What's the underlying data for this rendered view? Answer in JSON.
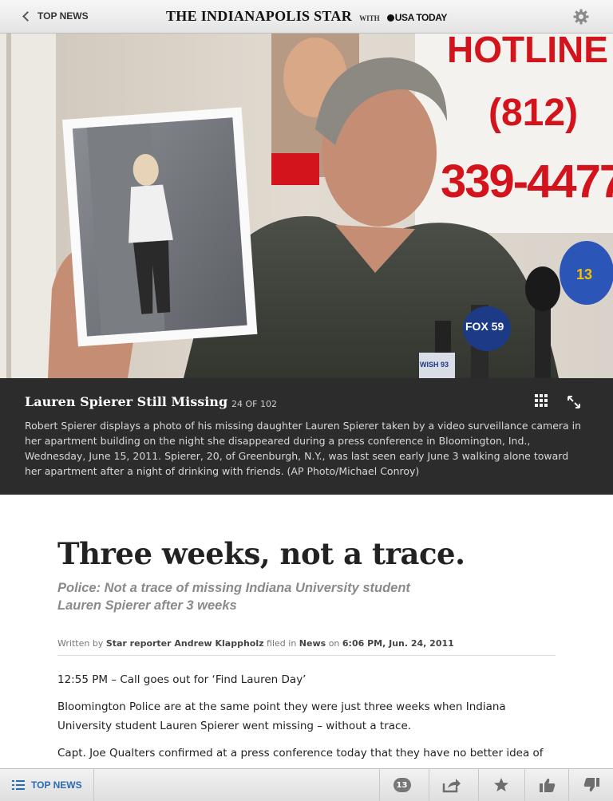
{
  "header": {
    "back_label": "TOP NEWS",
    "paper_name": "The Indianapolis Star",
    "with_label": "WITH",
    "partner_name": "USA TODAY"
  },
  "photo": {
    "sign_top": "HOTLINE",
    "sign_area": "(812)",
    "sign_number": "339-4477",
    "mic_labels": [
      "FOX 59",
      "13",
      "WISH 93"
    ]
  },
  "caption": {
    "title": "Lauren Spierer Still Missing",
    "counter": "24 OF 102",
    "text": "Robert Spierer displays a photo of his missing daughter Lauren Spierer taken by a video surveillance camera in her apartment building on the night she disappeared during a press conference in Bloomington, Ind., Wednesday, June 15, 2011. Spierer, 20, of Greenburgh, N.Y., was last seen early June 3 walking alone toward her apartment after a night of drinking with friends. (AP Photo/Michael Conroy)"
  },
  "article": {
    "headline": "Three weeks, not a trace.",
    "subhead": "Police: Not a trace of missing Indiana University student Lauren Spierer after 3 weeks",
    "byline": {
      "written_by": "Written by",
      "author": "Star reporter Andrew Klappholz",
      "filed_in": "filed in",
      "section": "News",
      "on": "on",
      "datetime": "6:06 PM, Jun. 24, 2011"
    },
    "paragraphs": [
      "12:55 PM – Call goes out for ‘Find Lauren Day’",
      "Bloomington Police are at the same point they were just three weeks when Indiana University student Lauren Spierer went missing – without a trace.",
      "Capt. Joe Qualters confirmed at a press conference today that they have no better idea of"
    ]
  },
  "footer": {
    "top_news_label": "TOP NEWS",
    "comment_count": "13"
  },
  "colors": {
    "caption_bg": "#2c2c2c",
    "link_blue": "#2a6bb5",
    "sign_red": "#d4141c"
  }
}
